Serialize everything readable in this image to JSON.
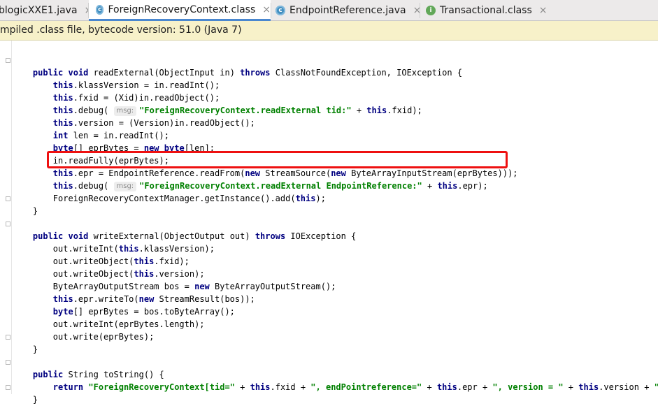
{
  "tabs": [
    {
      "label": "blogicXXE1.java",
      "icon": "java-class-icon"
    },
    {
      "label": "ForeignRecoveryContext.class",
      "icon": "class-file-icon",
      "active": true
    },
    {
      "label": "EndpointReference.java",
      "icon": "class-file-icon"
    },
    {
      "label": "Transactional.class",
      "icon": "interface-file-icon"
    }
  ],
  "tab_close_glyph": "×",
  "banner": {
    "text": "mpiled .class file, bytecode version: 51.0 (Java 7)"
  },
  "colors": {
    "keyword": "#000080",
    "string": "#008000",
    "highlight_box": "#ee1010",
    "active_tab_underline": "#4a87cf",
    "banner_bg": "#f7f1c9"
  },
  "code_lines": [
    [],
    [
      {
        "t": "    "
      },
      {
        "t": "public",
        "k": "kw"
      },
      {
        "t": " "
      },
      {
        "t": "void",
        "k": "kw"
      },
      {
        "t": " readExternal(ObjectInput in) "
      },
      {
        "t": "throws",
        "k": "kw"
      },
      {
        "t": " ClassNotFoundException, IOException {"
      }
    ],
    [
      {
        "t": "        "
      },
      {
        "t": "this",
        "k": "kw"
      },
      {
        "t": ".klassVersion = in.readInt();"
      }
    ],
    [
      {
        "t": "        "
      },
      {
        "t": "this",
        "k": "kw"
      },
      {
        "t": ".fxid = (Xid)in.readObject();"
      }
    ],
    [
      {
        "t": "        "
      },
      {
        "t": "this",
        "k": "kw"
      },
      {
        "t": ".debug( "
      },
      {
        "t": "msg:",
        "k": "hint"
      },
      {
        "t": "\"ForeignRecoveryContext.readExternal tid:\"",
        "k": "str"
      },
      {
        "t": " + "
      },
      {
        "t": "this",
        "k": "kw"
      },
      {
        "t": ".fxid);"
      }
    ],
    [
      {
        "t": "        "
      },
      {
        "t": "this",
        "k": "kw"
      },
      {
        "t": ".version = (Version)in.readObject();"
      }
    ],
    [
      {
        "t": "        "
      },
      {
        "t": "int",
        "k": "kw"
      },
      {
        "t": " len = in.readInt();"
      }
    ],
    [
      {
        "t": "        "
      },
      {
        "t": "byte",
        "k": "kw"
      },
      {
        "t": "[] eprBytes = "
      },
      {
        "t": "new",
        "k": "kw"
      },
      {
        "t": " "
      },
      {
        "t": "byte",
        "k": "kw"
      },
      {
        "t": "[len];"
      }
    ],
    [
      {
        "t": "        in.readFully(eprBytes);"
      }
    ],
    [
      {
        "t": "        "
      },
      {
        "t": "this",
        "k": "kw"
      },
      {
        "t": ".epr = EndpointReference.readFrom("
      },
      {
        "t": "new",
        "k": "kw"
      },
      {
        "t": " StreamSource("
      },
      {
        "t": "new",
        "k": "kw"
      },
      {
        "t": " ByteArrayInputStream(eprBytes)));"
      }
    ],
    [
      {
        "t": "        "
      },
      {
        "t": "this",
        "k": "kw"
      },
      {
        "t": ".debug( "
      },
      {
        "t": "msg:",
        "k": "hint"
      },
      {
        "t": "\"ForeignRecoveryContext.readExternal EndpointReference:\"",
        "k": "str"
      },
      {
        "t": " + "
      },
      {
        "t": "this",
        "k": "kw"
      },
      {
        "t": ".epr);"
      }
    ],
    [
      {
        "t": "        ForeignRecoveryContextManager.getInstance().add("
      },
      {
        "t": "this",
        "k": "kw"
      },
      {
        "t": ");"
      }
    ],
    [
      {
        "t": "    }"
      }
    ],
    [],
    [
      {
        "t": "    "
      },
      {
        "t": "public",
        "k": "kw"
      },
      {
        "t": " "
      },
      {
        "t": "void",
        "k": "kw"
      },
      {
        "t": " writeExternal(ObjectOutput out) "
      },
      {
        "t": "throws",
        "k": "kw"
      },
      {
        "t": " IOException {"
      }
    ],
    [
      {
        "t": "        out.writeInt("
      },
      {
        "t": "this",
        "k": "kw"
      },
      {
        "t": ".klassVersion);"
      }
    ],
    [
      {
        "t": "        out.writeObject("
      },
      {
        "t": "this",
        "k": "kw"
      },
      {
        "t": ".fxid);"
      }
    ],
    [
      {
        "t": "        out.writeObject("
      },
      {
        "t": "this",
        "k": "kw"
      },
      {
        "t": ".version);"
      }
    ],
    [
      {
        "t": "        ByteArrayOutputStream bos = "
      },
      {
        "t": "new",
        "k": "kw"
      },
      {
        "t": " ByteArrayOutputStream();"
      }
    ],
    [
      {
        "t": "        "
      },
      {
        "t": "this",
        "k": "kw"
      },
      {
        "t": ".epr.writeTo("
      },
      {
        "t": "new",
        "k": "kw"
      },
      {
        "t": " StreamResult(bos));"
      }
    ],
    [
      {
        "t": "        "
      },
      {
        "t": "byte",
        "k": "kw"
      },
      {
        "t": "[] eprBytes = bos.toByteArray();"
      }
    ],
    [
      {
        "t": "        out.writeInt(eprBytes.length);"
      }
    ],
    [
      {
        "t": "        out.write(eprBytes);"
      }
    ],
    [
      {
        "t": "    }"
      }
    ],
    [],
    [
      {
        "t": "    "
      },
      {
        "t": "public",
        "k": "kw"
      },
      {
        "t": " String toString() {"
      }
    ],
    [
      {
        "t": "        "
      },
      {
        "t": "return",
        "k": "kw"
      },
      {
        "t": " "
      },
      {
        "t": "\"ForeignRecoveryContext[tid=\"",
        "k": "str"
      },
      {
        "t": " + "
      },
      {
        "t": "this",
        "k": "kw"
      },
      {
        "t": ".fxid + "
      },
      {
        "t": "\", endPointreference=\"",
        "k": "str"
      },
      {
        "t": " + "
      },
      {
        "t": "this",
        "k": "kw"
      },
      {
        "t": ".epr + "
      },
      {
        "t": "\", version = \"",
        "k": "str"
      },
      {
        "t": " + "
      },
      {
        "t": "this",
        "k": "kw"
      },
      {
        "t": ".version + "
      },
      {
        "t": "\"]\"",
        "k": "str"
      },
      {
        "t": ";"
      }
    ],
    [
      {
        "t": "    }"
      }
    ]
  ]
}
